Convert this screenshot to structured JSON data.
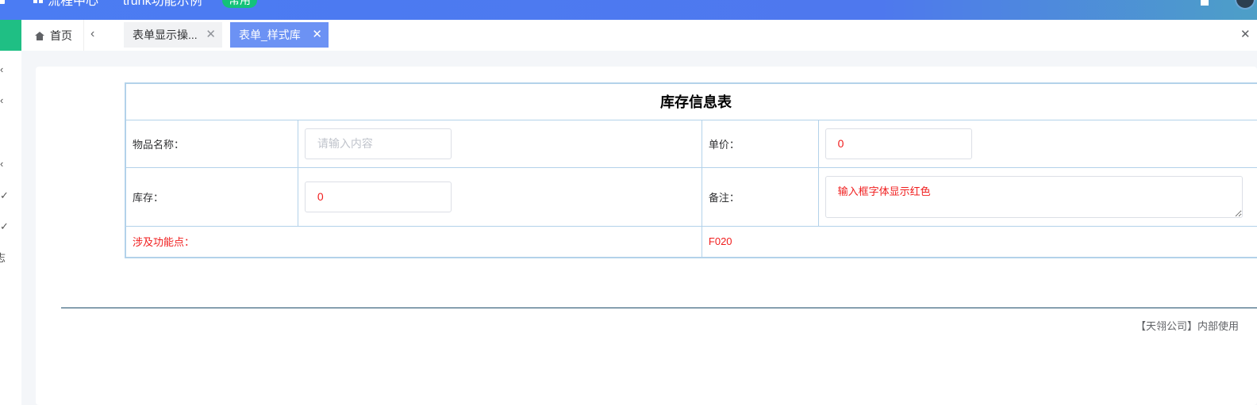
{
  "topbar": {
    "nav_items": [
      "流程中心",
      "trunk功能示例"
    ],
    "badge": "常用"
  },
  "sidebar": {
    "icons": [
      "chevron-left-icon",
      "chevron-left-icon",
      "chevron-left-icon",
      "check-icon",
      "check-icon"
    ],
    "partial_label": "志"
  },
  "tabs": {
    "home": "首页",
    "items": [
      {
        "label": "表单显示操...",
        "active": false
      },
      {
        "label": "表单_样式库",
        "active": true
      }
    ]
  },
  "form": {
    "title": "库存信息表",
    "item_name_label": "物品名称：",
    "item_name_placeholder": "请输入内容",
    "item_name_value": "",
    "price_label": "单价：",
    "price_value": "0",
    "stock_label": "库存：",
    "stock_value": "0",
    "remark_label": "备注：",
    "remark_value": "输入框字体显示红色",
    "feature_label": "涉及功能点：",
    "feature_value": "F020"
  },
  "footer": {
    "text": "【天翎公司】内部使用"
  },
  "colors": {
    "accent": "#4b7cf3",
    "active_tab": "#6c92f4",
    "badge": "#13c27a",
    "sidebar_active": "#1fbf84",
    "red_text": "#f01d1d",
    "table_border": "#b3d2ea"
  }
}
